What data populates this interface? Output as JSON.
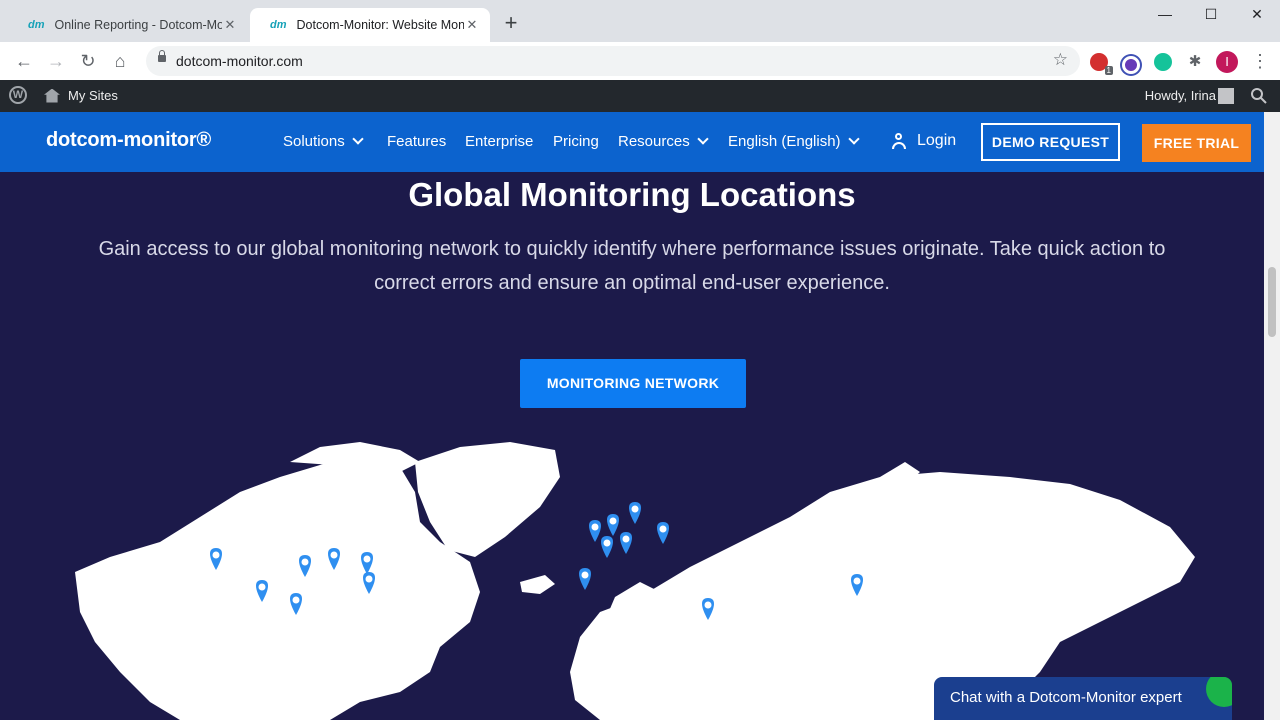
{
  "browser": {
    "tabs": [
      {
        "favicon": "dm",
        "title": "Online Reporting - Dotcom-Monitor",
        "active": false
      },
      {
        "favicon": "dm",
        "title": "Dotcom-Monitor: Website Monitoring",
        "active": true
      }
    ],
    "url": "dotcom-monitor.com",
    "profile_initial": "I",
    "extension_badge": "1"
  },
  "wp_admin_bar": {
    "my_sites_label": "My Sites",
    "howdy_label": "Howdy, Irina"
  },
  "site_nav": {
    "logo_text": "dotcom-monitor®",
    "items": [
      {
        "label": "Solutions",
        "has_dropdown": true
      },
      {
        "label": "Features",
        "has_dropdown": false
      },
      {
        "label": "Enterprise",
        "has_dropdown": false
      },
      {
        "label": "Pricing",
        "has_dropdown": false
      },
      {
        "label": "Resources",
        "has_dropdown": true
      },
      {
        "label": "English (English)",
        "has_dropdown": true
      }
    ],
    "login_label": "Login",
    "demo_label": "DEMO REQUEST",
    "trial_label": "FREE TRIAL"
  },
  "hero": {
    "title": "Global Monitoring Locations",
    "subtitle": "Gain access to our global monitoring network to quickly identify where performance issues originate. Take quick action to correct errors and ensure an optimal end-user experience.",
    "cta_label": "MONITORING NETWORK"
  },
  "chat_widget": {
    "label": "Chat with a Dotcom-Monitor expert"
  },
  "colors": {
    "brand_blue": "#0c63ce",
    "hero_bg": "#1c1a4a",
    "trial_orange": "#f58220",
    "pin_blue": "#2f8ff0"
  }
}
